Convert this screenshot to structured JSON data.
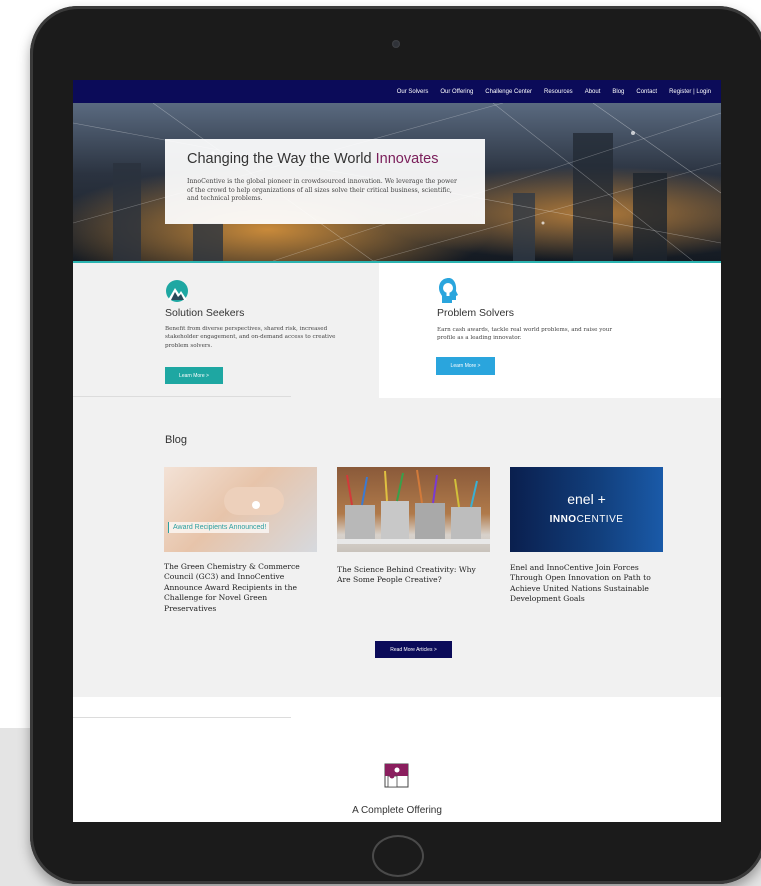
{
  "nav": {
    "items": [
      "Our Solvers",
      "Our Offering",
      "Challenge Center",
      "Resources",
      "About",
      "Blog",
      "Contact",
      "Register | Login"
    ]
  },
  "hero": {
    "title_prefix": "Changing the Way the World ",
    "title_accent": "Innovates",
    "text": "InnoCentive is the global pioneer in crowdsourced innovation. We leverage the power of the crowd to help organizations of all sizes solve their critical business, scientific, and technical problems."
  },
  "seekers": {
    "icon": "mountain-icon",
    "heading": "Solution Seekers",
    "text": "Benefit from diverse perspectives, shared risk, increased stakeholder engagement, and on-demand access to creative problem solvers.",
    "button": "Learn More >"
  },
  "solvers": {
    "icon": "lightbulb-head-icon",
    "heading": "Problem Solvers",
    "text": "Earn cash awards, tackle real world problems, and raise your profile as a leading innovator.",
    "button": "Learn More >"
  },
  "blog": {
    "heading": "Blog",
    "cards": [
      {
        "image_label": "Award Recipients Announced!",
        "title": "The Green Chemistry & Commerce Council (GC3) and InnoCentive Announce Award Recipients in the Challenge for Novel Green Preservatives"
      },
      {
        "title": "The Science Behind Creativity: Why Are Some People Creative?"
      },
      {
        "logo_top": "enel +",
        "logo_bold": "INNO",
        "logo_rest": "CENTIVE",
        "title": "Enel and InnoCentive Join Forces Through Open Innovation on Path to Achieve United Nations Sustainable Development Goals"
      }
    ],
    "button": "Read More Articles >"
  },
  "offering": {
    "icon": "puzzle-icon",
    "heading": "A Complete Offering"
  },
  "colors": {
    "nav_bg": "#0b0b59",
    "accent_teal": "#1ea7a2",
    "accent_blue": "#2aa5dd",
    "accent_magenta": "#7a1e5a"
  }
}
